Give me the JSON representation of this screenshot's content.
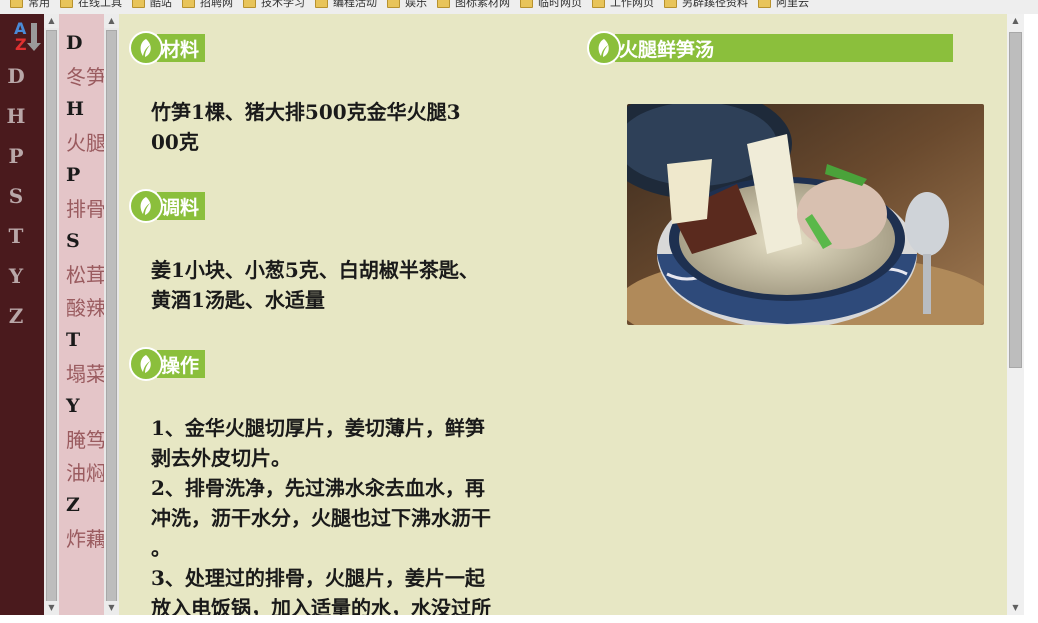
{
  "bookmarks": [
    "常用",
    "在线工具",
    "酷站",
    "招聘网",
    "技术学习",
    "编程活动",
    "娱乐",
    "图标素材网",
    "临时网页",
    "工作网页",
    "另辟蹊径资料",
    "阿里云"
  ],
  "rail": {
    "sort_icon": "az-sort-icon",
    "letters": [
      "D",
      "H",
      "P",
      "S",
      "T",
      "Y",
      "Z"
    ]
  },
  "index": {
    "groups": [
      {
        "letter": "D",
        "items": [
          "冬笋"
        ]
      },
      {
        "letter": "H",
        "items": [
          "火腿"
        ]
      },
      {
        "letter": "P",
        "items": [
          "排骨"
        ]
      },
      {
        "letter": "S",
        "items": [
          "松茸",
          "酸辣"
        ]
      },
      {
        "letter": "T",
        "items": [
          "塌菜"
        ]
      },
      {
        "letter": "Y",
        "items": [
          "腌笃",
          "油焖"
        ]
      },
      {
        "letter": "Z",
        "items": [
          "炸藕"
        ]
      }
    ]
  },
  "recipe": {
    "title": "火腿鲜笋汤",
    "photo_alt_icon": "soup-bowl-photo",
    "sections": [
      {
        "heading": "材料",
        "lines": [
          "竹笋1棵、猪大排500克金华火腿3",
          "00克"
        ]
      },
      {
        "heading": "调料",
        "lines": [
          "姜1小块、小葱5克、白胡椒半茶匙、",
          "黄酒1汤匙、水适量"
        ]
      },
      {
        "heading": "操作",
        "lines": [
          "1、金华火腿切厚片，姜切薄片，鲜笋",
          "剥去外皮切片。",
          "2、排骨洗净，先过沸水汆去血水，再",
          "冲洗，沥干水分，火腿也过下沸水沥干",
          "。",
          "3、处理过的排骨，火腿片，姜片一起",
          "放入电饭锅，加入适量的水，水没过所"
        ]
      }
    ]
  },
  "colors": {
    "rail_bg": "#4a1a1d",
    "index_bg": "#e4c5c8",
    "main_bg": "#e7e7c4",
    "accent_green": "#8bbf3c"
  }
}
